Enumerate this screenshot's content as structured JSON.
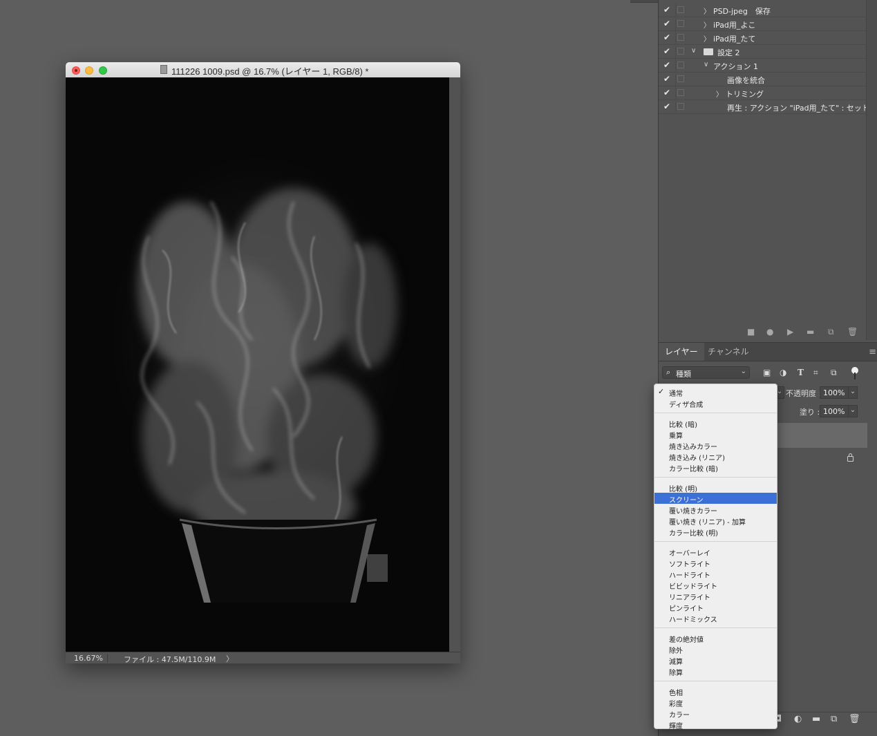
{
  "document": {
    "title": "111226 1009.psd @ 16.7% (レイヤー 1, RGB/8) *",
    "zoom": "16.67%",
    "file_info": "ファイル : 47.5M/110.9M",
    "status_arrow": "〉"
  },
  "actions": {
    "rows": [
      {
        "check": "✔",
        "twisty": "〉",
        "label": "PSD-jpeg　保存",
        "indent": 0,
        "folder": false
      },
      {
        "check": "✔",
        "twisty": "〉",
        "label": "iPad用_よこ",
        "indent": 0,
        "folder": false
      },
      {
        "check": "✔",
        "twisty": "〉",
        "label": "iPad用_たて",
        "indent": 0,
        "folder": false
      },
      {
        "check": "✔",
        "twisty": "∨",
        "label": "設定 2",
        "indent": -1,
        "folder": true
      },
      {
        "check": "✔",
        "twisty": "∨",
        "label": "アクション 1",
        "indent": 0,
        "folder": false
      },
      {
        "check": "✔",
        "twisty": "",
        "label": "画像を統合",
        "indent": 1,
        "folder": false
      },
      {
        "check": "✔",
        "twisty": "〉",
        "label": "トリミング",
        "indent": 1,
        "folder": false
      },
      {
        "check": "✔",
        "twisty": "",
        "label": "再生 : アクション \"iPad用_たて\" : セット...",
        "indent": 1,
        "folder": false
      }
    ],
    "toolbar_icons": [
      "stop-icon",
      "record-icon",
      "play-icon",
      "folder-icon",
      "new-action-icon",
      "trash-icon"
    ],
    "toolbar_glyphs": [
      "■",
      "●",
      "▶",
      "▬",
      "⧉",
      "🗑"
    ]
  },
  "layers_panel": {
    "tabs": [
      "レイヤー",
      "チャンネル"
    ],
    "menu_glyph": "≡",
    "kind_label": "種類",
    "kind_icon": "⌕",
    "dropdown_glyph": "⌄",
    "filter_glyphs": [
      "▣",
      "◑",
      "T",
      "⌗",
      "⧉"
    ],
    "opacity_label": "不透明度 :",
    "opacity_value": "100%",
    "fill_label": "塗り :",
    "fill_value": "100%",
    "footer_glyphs": [
      "◘",
      "◐",
      "▬",
      "⧉",
      "🗑"
    ]
  },
  "blend_menu": {
    "groups": [
      [
        "通常",
        "ディザ合成"
      ],
      [
        "比較 (暗)",
        "乗算",
        "焼き込みカラー",
        "焼き込み (リニア)",
        "カラー比較 (暗)"
      ],
      [
        "比較 (明)",
        "スクリーン",
        "覆い焼きカラー",
        "覆い焼き (リニア) - 加算",
        "カラー比較 (明)"
      ],
      [
        "オーバーレイ",
        "ソフトライト",
        "ハードライト",
        "ビビッドライト",
        "リニアライト",
        "ピンライト",
        "ハードミックス"
      ],
      [
        "差の絶対値",
        "除外",
        "減算",
        "除算"
      ],
      [
        "色相",
        "彩度",
        "カラー",
        "輝度"
      ]
    ],
    "checked": "通常",
    "checkmark": "✓",
    "highlighted": "スクリーン",
    "highlight_color": "#3d70d6"
  }
}
